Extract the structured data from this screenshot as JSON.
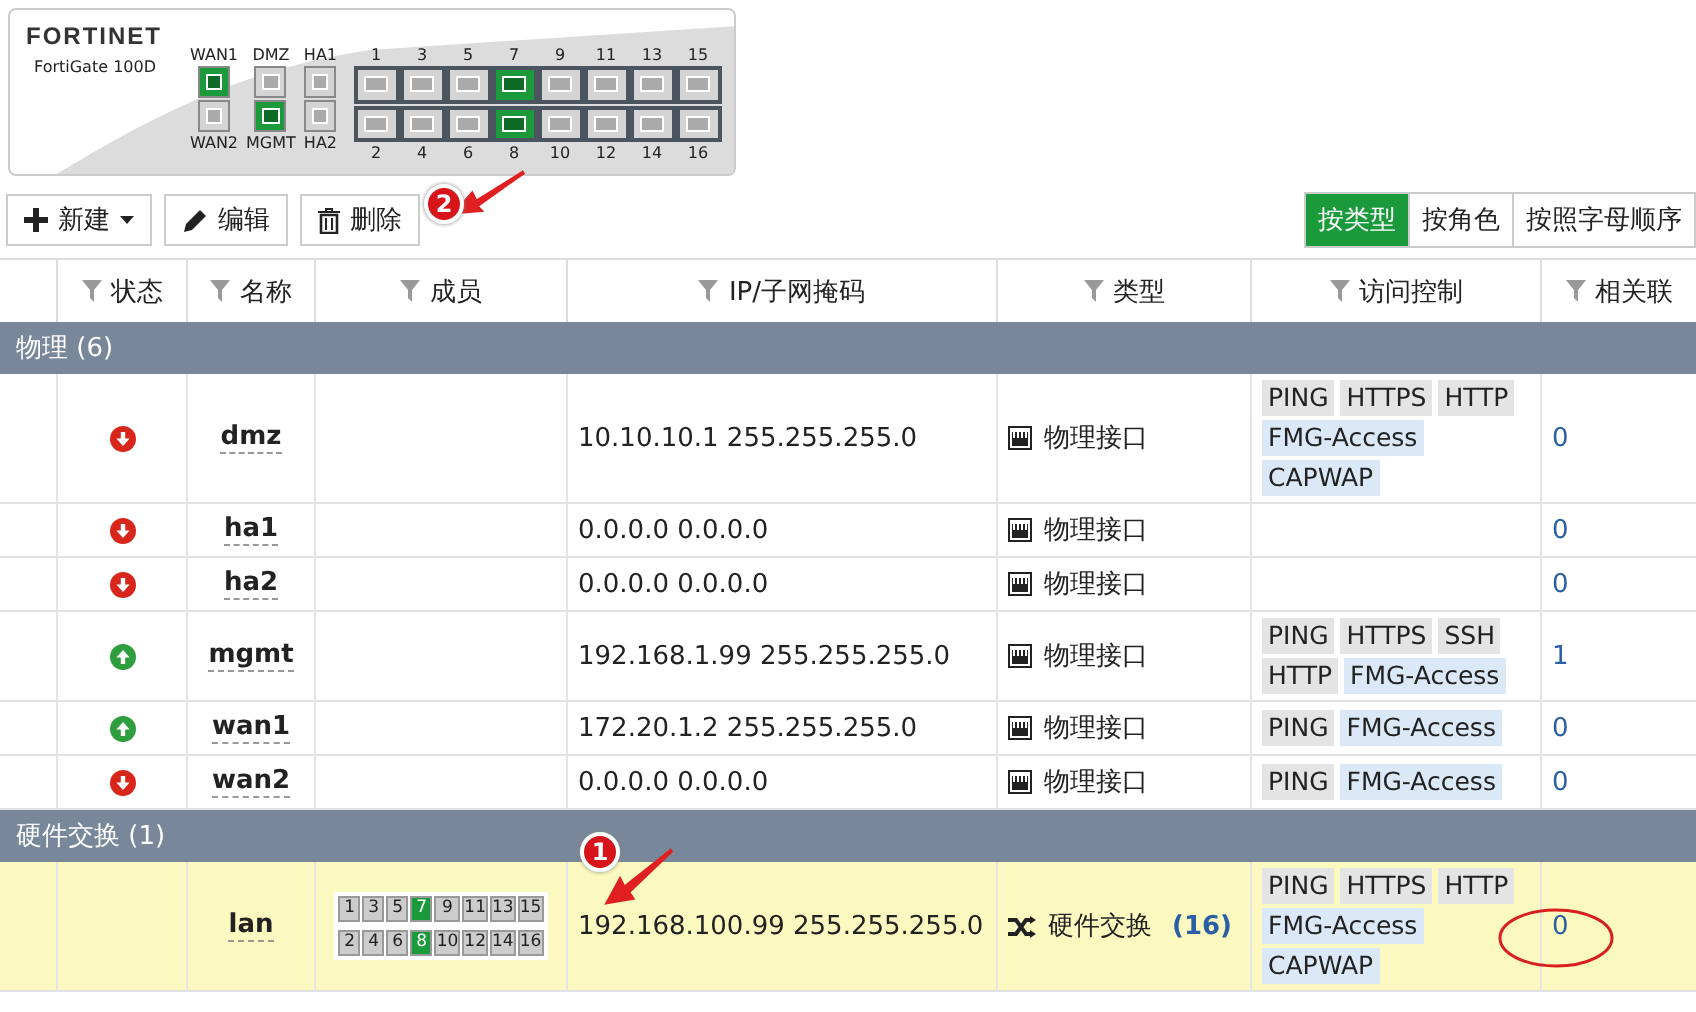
{
  "device": {
    "brand": "FORTINET",
    "model": "FortiGate 100D",
    "left_ports": [
      {
        "top_label": "WAN1",
        "top_active": true,
        "bottom_label": "WAN2",
        "bottom_active": false
      },
      {
        "top_label": "DMZ",
        "top_active": false,
        "bottom_label": "MGMT",
        "bottom_active": true
      },
      {
        "top_label": "HA1",
        "top_active": false,
        "bottom_label": "HA2",
        "bottom_active": false
      }
    ],
    "switch_ports": [
      {
        "top_label": "1",
        "top_active": false,
        "bottom_label": "2",
        "bottom_active": false
      },
      {
        "top_label": "3",
        "top_active": false,
        "bottom_label": "4",
        "bottom_active": false
      },
      {
        "top_label": "5",
        "top_active": false,
        "bottom_label": "6",
        "bottom_active": false
      },
      {
        "top_label": "7",
        "top_active": true,
        "bottom_label": "8",
        "bottom_active": true
      },
      {
        "top_label": "9",
        "top_active": false,
        "bottom_label": "10",
        "bottom_active": false
      },
      {
        "top_label": "11",
        "top_active": false,
        "bottom_label": "12",
        "bottom_active": false
      },
      {
        "top_label": "13",
        "top_active": false,
        "bottom_label": "14",
        "bottom_active": false
      },
      {
        "top_label": "15",
        "top_active": false,
        "bottom_label": "16",
        "bottom_active": false
      }
    ]
  },
  "toolbar": {
    "buttons": [
      {
        "kind": "new",
        "label": "新建"
      },
      {
        "kind": "edit",
        "label": "编辑"
      },
      {
        "kind": "delete",
        "label": "删除"
      }
    ],
    "views": [
      {
        "label": "按类型",
        "selected": true
      },
      {
        "label": "按角色",
        "selected": false
      },
      {
        "label": "按照字母顺序",
        "selected": false
      }
    ]
  },
  "table": {
    "columns": [
      "状态",
      "名称",
      "成员",
      "IP/子网掩码",
      "类型",
      "访问控制",
      "相关联"
    ],
    "groups": [
      {
        "title": "物理 (6)",
        "rows": [
          {
            "status_up": false,
            "name": "dmz",
            "ip": "10.10.10.1 255.255.255.0",
            "type": "物理接口",
            "kind": "physical",
            "access": [
              {
                "label": "PING",
                "kind": "basic"
              },
              {
                "label": "HTTPS",
                "kind": "basic"
              },
              {
                "label": "HTTP",
                "kind": "basic"
              },
              {
                "label": "FMG-Access",
                "kind": "fabric"
              },
              {
                "label": "CAPWAP",
                "kind": "fabric"
              }
            ],
            "refs": "0"
          },
          {
            "status_up": false,
            "name": "ha1",
            "ip": "0.0.0.0 0.0.0.0",
            "type": "物理接口",
            "kind": "physical",
            "access": [],
            "refs": "0"
          },
          {
            "status_up": false,
            "name": "ha2",
            "ip": "0.0.0.0 0.0.0.0",
            "type": "物理接口",
            "kind": "physical",
            "access": [],
            "refs": "0"
          },
          {
            "status_up": true,
            "name": "mgmt",
            "ip": "192.168.1.99 255.255.255.0",
            "type": "物理接口",
            "kind": "physical",
            "access": [
              {
                "label": "PING",
                "kind": "basic"
              },
              {
                "label": "HTTPS",
                "kind": "basic"
              },
              {
                "label": "SSH",
                "kind": "basic"
              },
              {
                "label": "HTTP",
                "kind": "basic"
              },
              {
                "label": "FMG-Access",
                "kind": "fabric"
              }
            ],
            "refs": "1"
          },
          {
            "status_up": true,
            "name": "wan1",
            "ip": "172.20.1.2 255.255.255.0",
            "type": "物理接口",
            "kind": "physical",
            "access": [
              {
                "label": "PING",
                "kind": "basic"
              },
              {
                "label": "FMG-Access",
                "kind": "fabric"
              }
            ],
            "refs": "0"
          },
          {
            "status_up": false,
            "name": "wan2",
            "ip": "0.0.0.0 0.0.0.0",
            "type": "物理接口",
            "kind": "physical",
            "access": [
              {
                "label": "PING",
                "kind": "basic"
              },
              {
                "label": "FMG-Access",
                "kind": "fabric"
              }
            ],
            "refs": "0"
          }
        ]
      },
      {
        "title": "硬件交换 (1)",
        "rows": [
          {
            "name": "lan",
            "highlighted": true,
            "members": [
              {
                "label": "1",
                "active": false
              },
              {
                "label": "3",
                "active": false
              },
              {
                "label": "5",
                "active": false
              },
              {
                "label": "7",
                "active": true
              },
              {
                "label": "9",
                "active": false
              },
              {
                "label": "11",
                "active": false
              },
              {
                "label": "13",
                "active": false
              },
              {
                "label": "15",
                "active": false
              },
              {
                "label": "2",
                "active": false
              },
              {
                "label": "4",
                "active": false
              },
              {
                "label": "6",
                "active": false
              },
              {
                "label": "8",
                "active": true
              },
              {
                "label": "10",
                "active": false
              },
              {
                "label": "12",
                "active": false
              },
              {
                "label": "14",
                "active": false
              },
              {
                "label": "16",
                "active": false
              }
            ],
            "ip": "192.168.100.99 255.255.255.0",
            "type": "硬件交换",
            "kind": "switch",
            "type_count": "(16)",
            "access": [
              {
                "label": "PING",
                "kind": "basic"
              },
              {
                "label": "HTTPS",
                "kind": "basic"
              },
              {
                "label": "HTTP",
                "kind": "basic"
              },
              {
                "label": "FMG-Access",
                "kind": "fabric"
              },
              {
                "label": "CAPWAP",
                "kind": "fabric"
              }
            ],
            "refs": "0"
          }
        ]
      }
    ]
  },
  "annotations": [
    {
      "label": "2"
    },
    {
      "label": "1"
    }
  ]
}
